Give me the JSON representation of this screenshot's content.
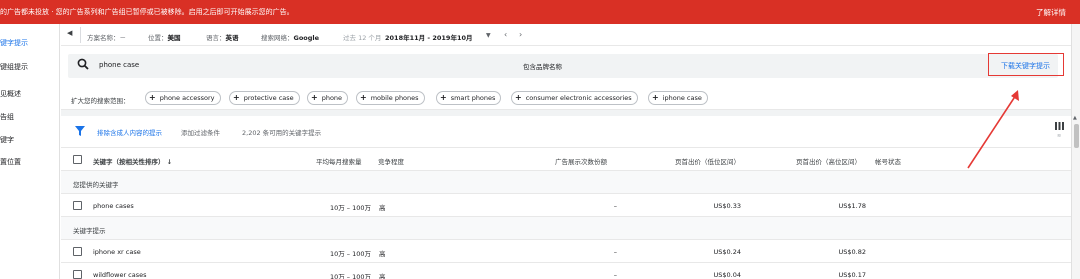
{
  "banner": {
    "message": "的广告都未投放 · 您的广告系列和广告组已暂停或已被移除。启用之后即可开始展示您的广告。",
    "link": "了解详情"
  },
  "sidebar": {
    "items": [
      {
        "label": "键字提示",
        "active": true
      },
      {
        "label": "键组提示"
      },
      {
        "label": "见概述"
      },
      {
        "label": "告组"
      },
      {
        "label": "键字"
      },
      {
        "label": "置位置"
      }
    ]
  },
  "filterbar": {
    "plan_name": "方案名称：－",
    "location_label": "位置：",
    "location_value": "美国",
    "language_label": "语言：",
    "language_value": "英语",
    "network_label": "搜索网络：",
    "network_value": "Google",
    "period_label": "过去 12 个月",
    "date_range": "2018年11月 - 2019年10月",
    "caret": "▼",
    "prev": "‹",
    "next": "›"
  },
  "search": {
    "query": "phone case",
    "brand_toggle_label": "包含品牌名称",
    "download_link": "下载关键字提示"
  },
  "expand": {
    "label": "扩大您的搜索范围：",
    "chips": [
      "phone accessory",
      "protective case",
      "phone",
      "mobile phones",
      "smart phones",
      "consumer electronic accessories",
      "iphone case"
    ]
  },
  "table_toolbar": {
    "exclude_link": "排除含成人内容的提示",
    "add_filter": "添加过滤条件",
    "result_count": "2,202 条可用的关键字提示"
  },
  "table": {
    "columns": {
      "keyword": "关键字（按相关性排序）",
      "sort_arrow": "↓",
      "avg_searches": "平均每月搜索量",
      "competition": "竞争程度",
      "impression_share": "广告展示次数份额",
      "bid_low": "页首出价（低位区间）",
      "bid_high": "页首出价（高位区间）",
      "account_status": "帐号状态"
    },
    "groups": [
      {
        "label": "您提供的关键字",
        "rows": [
          {
            "keyword": "phone cases",
            "searches": "10万 – 100万",
            "competition": "高",
            "share": "–",
            "bid_low": "US$0.33",
            "bid_high": "US$1.78"
          }
        ]
      },
      {
        "label": "关键字提示",
        "rows": [
          {
            "keyword": "iphone xr case",
            "searches": "10万 – 100万",
            "competition": "高",
            "share": "–",
            "bid_low": "US$0.24",
            "bid_high": "US$0.82"
          },
          {
            "keyword": "wildflower cases",
            "searches": "10万 – 100万",
            "competition": "高",
            "share": "–",
            "bid_low": "US$0.04",
            "bid_high": "US$0.17"
          }
        ]
      }
    ]
  },
  "colors": {
    "banner": "#d93025",
    "link": "#1a73e8",
    "annotation": "#e53935"
  }
}
